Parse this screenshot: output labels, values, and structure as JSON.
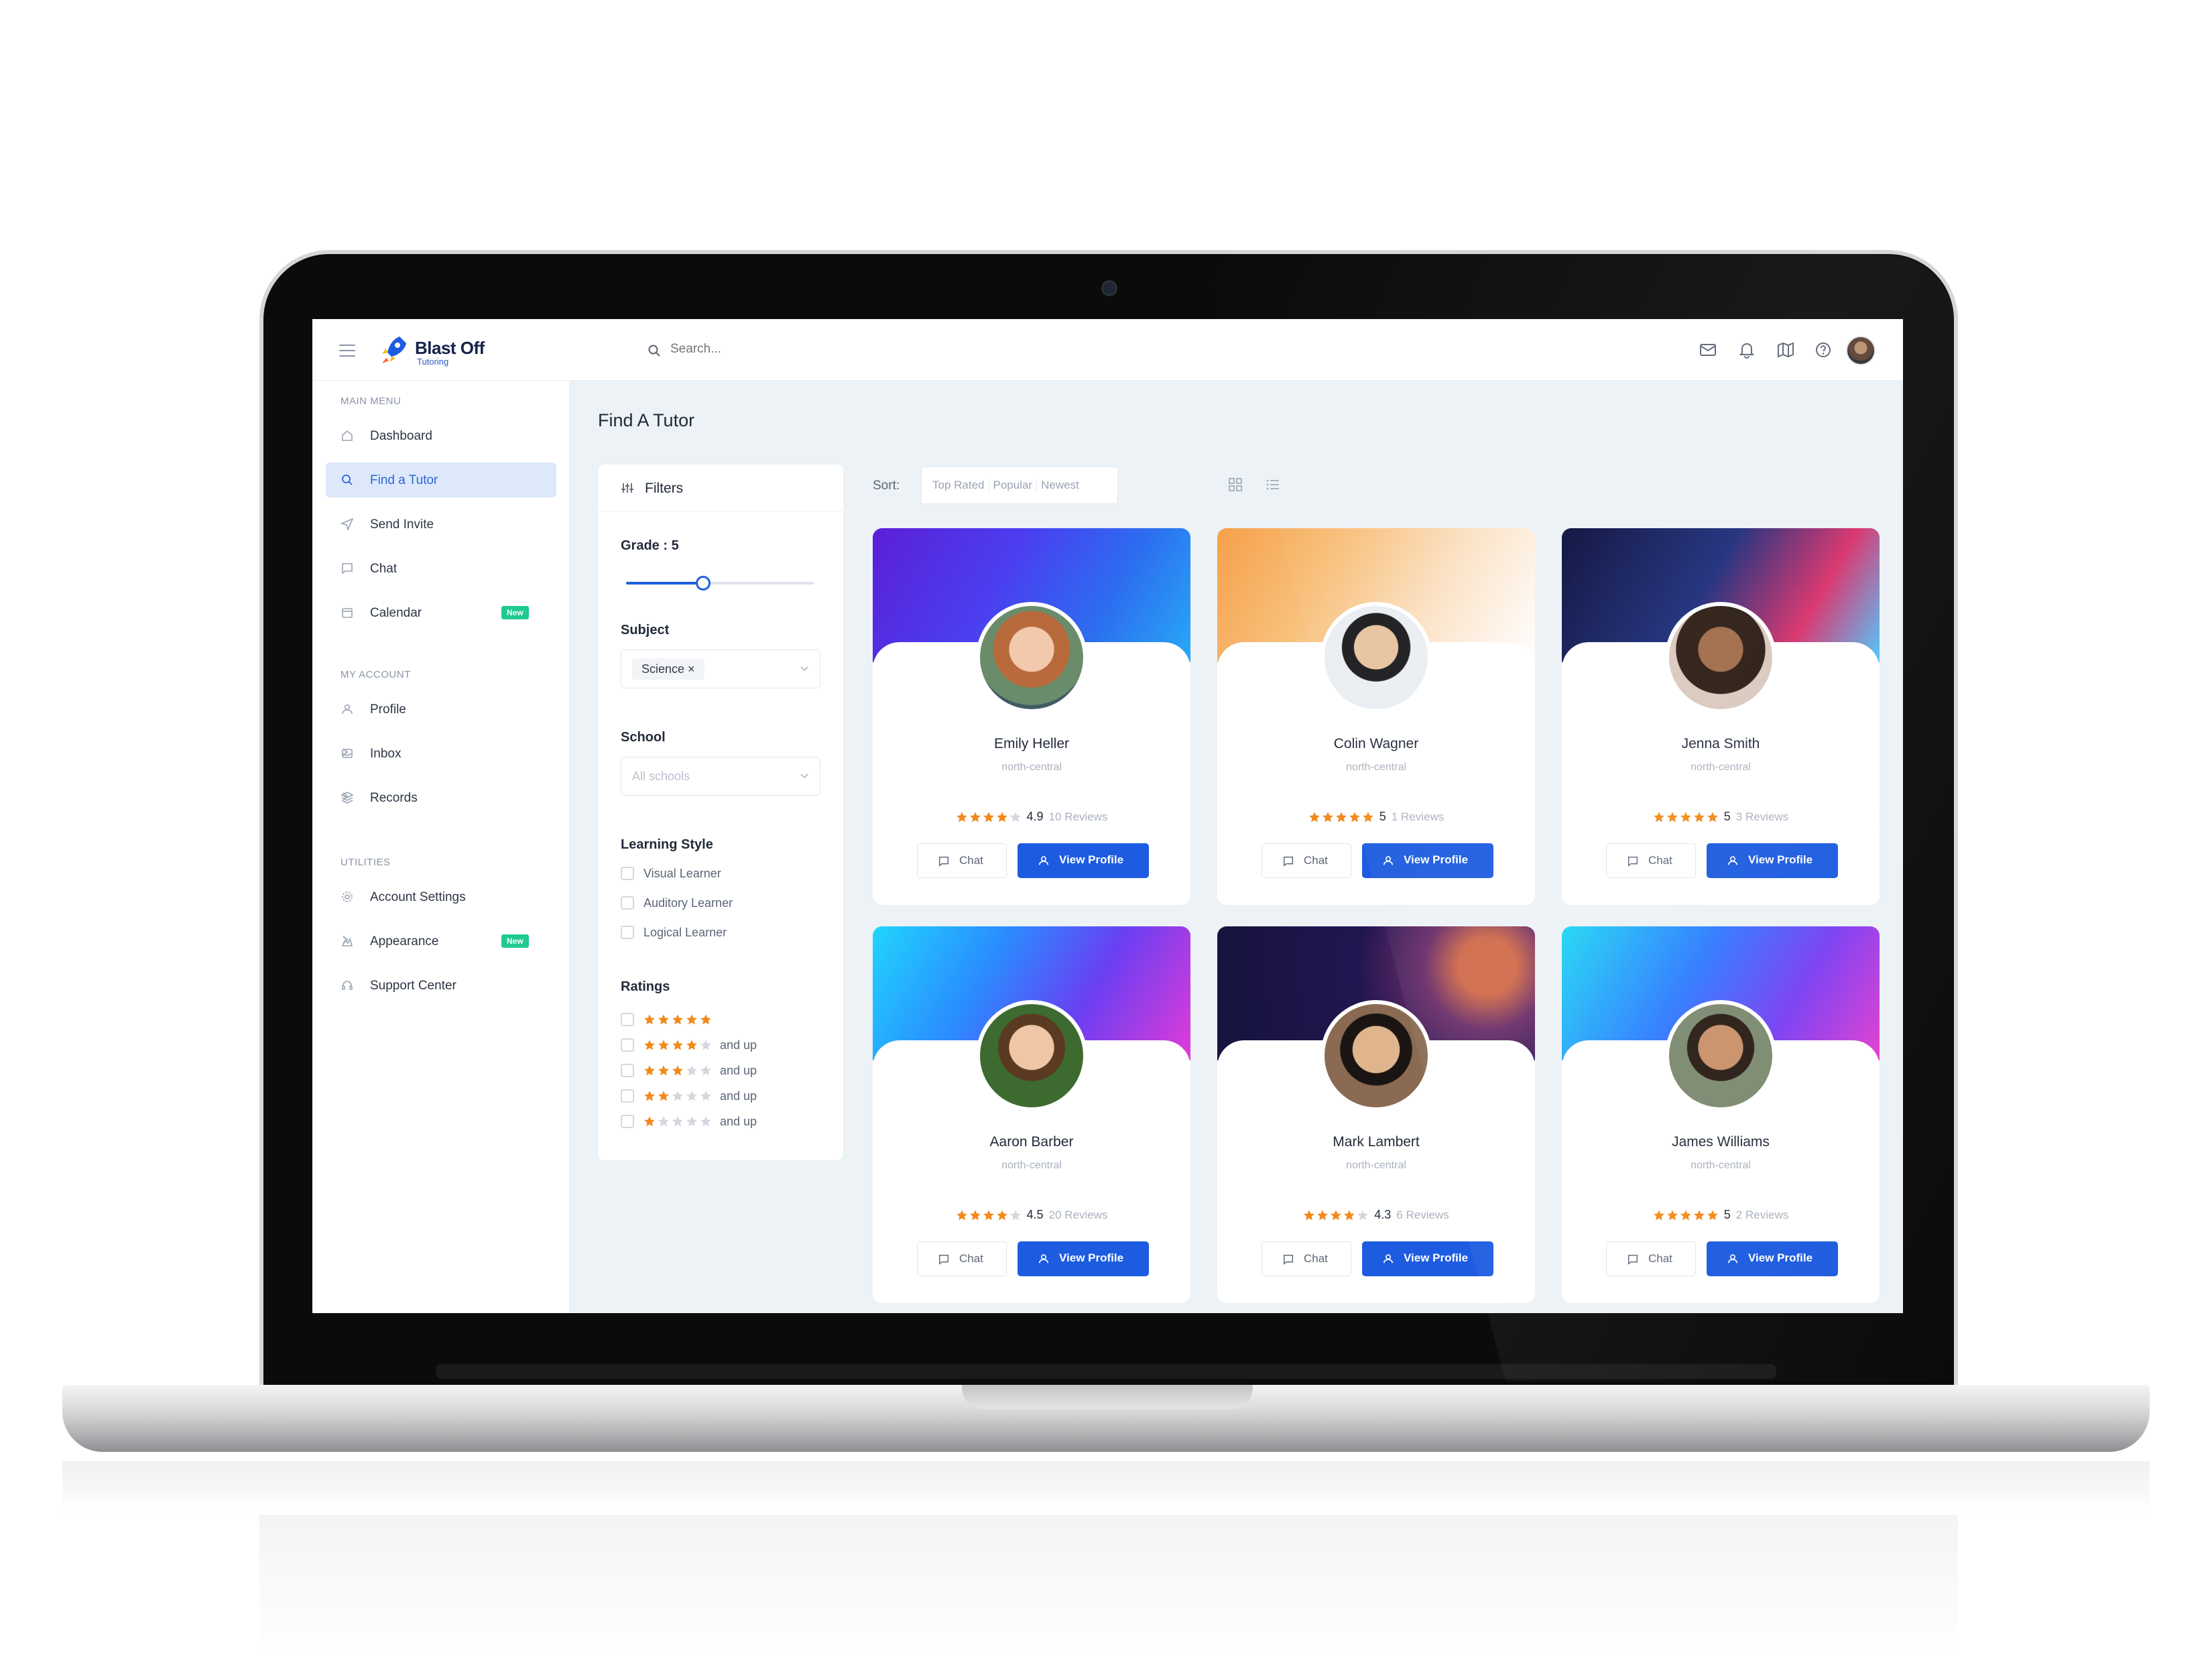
{
  "app": {
    "brand": "Blast Off",
    "brand_sub": "Tutoring"
  },
  "header": {
    "search_placeholder": "Search..."
  },
  "sidebar": {
    "sections": [
      {
        "title": "MAIN MENU",
        "items": [
          {
            "label": "Dashboard",
            "icon": "home-icon"
          },
          {
            "label": "Find a Tutor",
            "icon": "search-icon",
            "active": true
          },
          {
            "label": "Send Invite",
            "icon": "send-icon"
          },
          {
            "label": "Chat",
            "icon": "chat-icon"
          },
          {
            "label": "Calendar",
            "icon": "calendar-icon",
            "badge": "New"
          }
        ]
      },
      {
        "title": "MY ACCOUNT",
        "items": [
          {
            "label": "Profile",
            "icon": "user-icon"
          },
          {
            "label": "Inbox",
            "icon": "inbox-icon",
            "chevron": true
          },
          {
            "label": "Records",
            "icon": "layers-icon",
            "chevron": true
          }
        ]
      },
      {
        "title": "UTILITIES",
        "items": [
          {
            "label": "Account Settings",
            "icon": "gear-icon"
          },
          {
            "label": "Appearance",
            "icon": "appearance-icon",
            "badge": "New",
            "chevron": true
          },
          {
            "label": "Support Center",
            "icon": "headset-icon"
          }
        ]
      }
    ]
  },
  "main": {
    "title": "Find A Tutor",
    "filters": {
      "title": "Filters",
      "grade_label": "Grade : 5",
      "grade_level": 0.41,
      "subject_label": "Subject",
      "subject_value": "Science ×",
      "school_label": "School",
      "school_placeholder": "All schools",
      "learning_label": "Learning Style",
      "learning_options": [
        "Visual Learner",
        "Auditory Learner",
        "Logical Learner"
      ],
      "ratings_label": "Ratings",
      "rating_options": [
        {
          "stars": 5,
          "suffix": ""
        },
        {
          "stars": 4,
          "suffix": "and up"
        },
        {
          "stars": 3,
          "suffix": "and up"
        },
        {
          "stars": 2,
          "suffix": "and up"
        },
        {
          "stars": 1,
          "suffix": "and up"
        }
      ]
    },
    "sort": {
      "label": "Sort:",
      "options": [
        "Top Rated",
        "Popular",
        "Newest"
      ]
    },
    "tutors": [
      {
        "name": "Emily Heller",
        "region": "north-central",
        "stars": 4,
        "rating": "4.9",
        "reviews": "10 Reviews"
      },
      {
        "name": "Colin Wagner",
        "region": "north-central",
        "stars": 5,
        "rating": "5",
        "reviews": "1 Reviews"
      },
      {
        "name": "Jenna Smith",
        "region": "north-central",
        "stars": 5,
        "rating": "5",
        "reviews": "3 Reviews"
      },
      {
        "name": "Aaron Barber",
        "region": "north-central",
        "stars": 4,
        "rating": "4.5",
        "reviews": "20 Reviews"
      },
      {
        "name": "Mark Lambert",
        "region": "north-central",
        "stars": 4,
        "rating": "4.3",
        "reviews": "6 Reviews"
      },
      {
        "name": "James Williams",
        "region": "north-central",
        "stars": 5,
        "rating": "5",
        "reviews": "2 Reviews"
      }
    ],
    "buttons": {
      "chat": "Chat",
      "profile": "View Profile"
    }
  },
  "colors": {
    "accent": "#1d5ce0",
    "star": "#f28a1b",
    "badge": "#1fc98f",
    "bg": "#ecf2f6"
  }
}
